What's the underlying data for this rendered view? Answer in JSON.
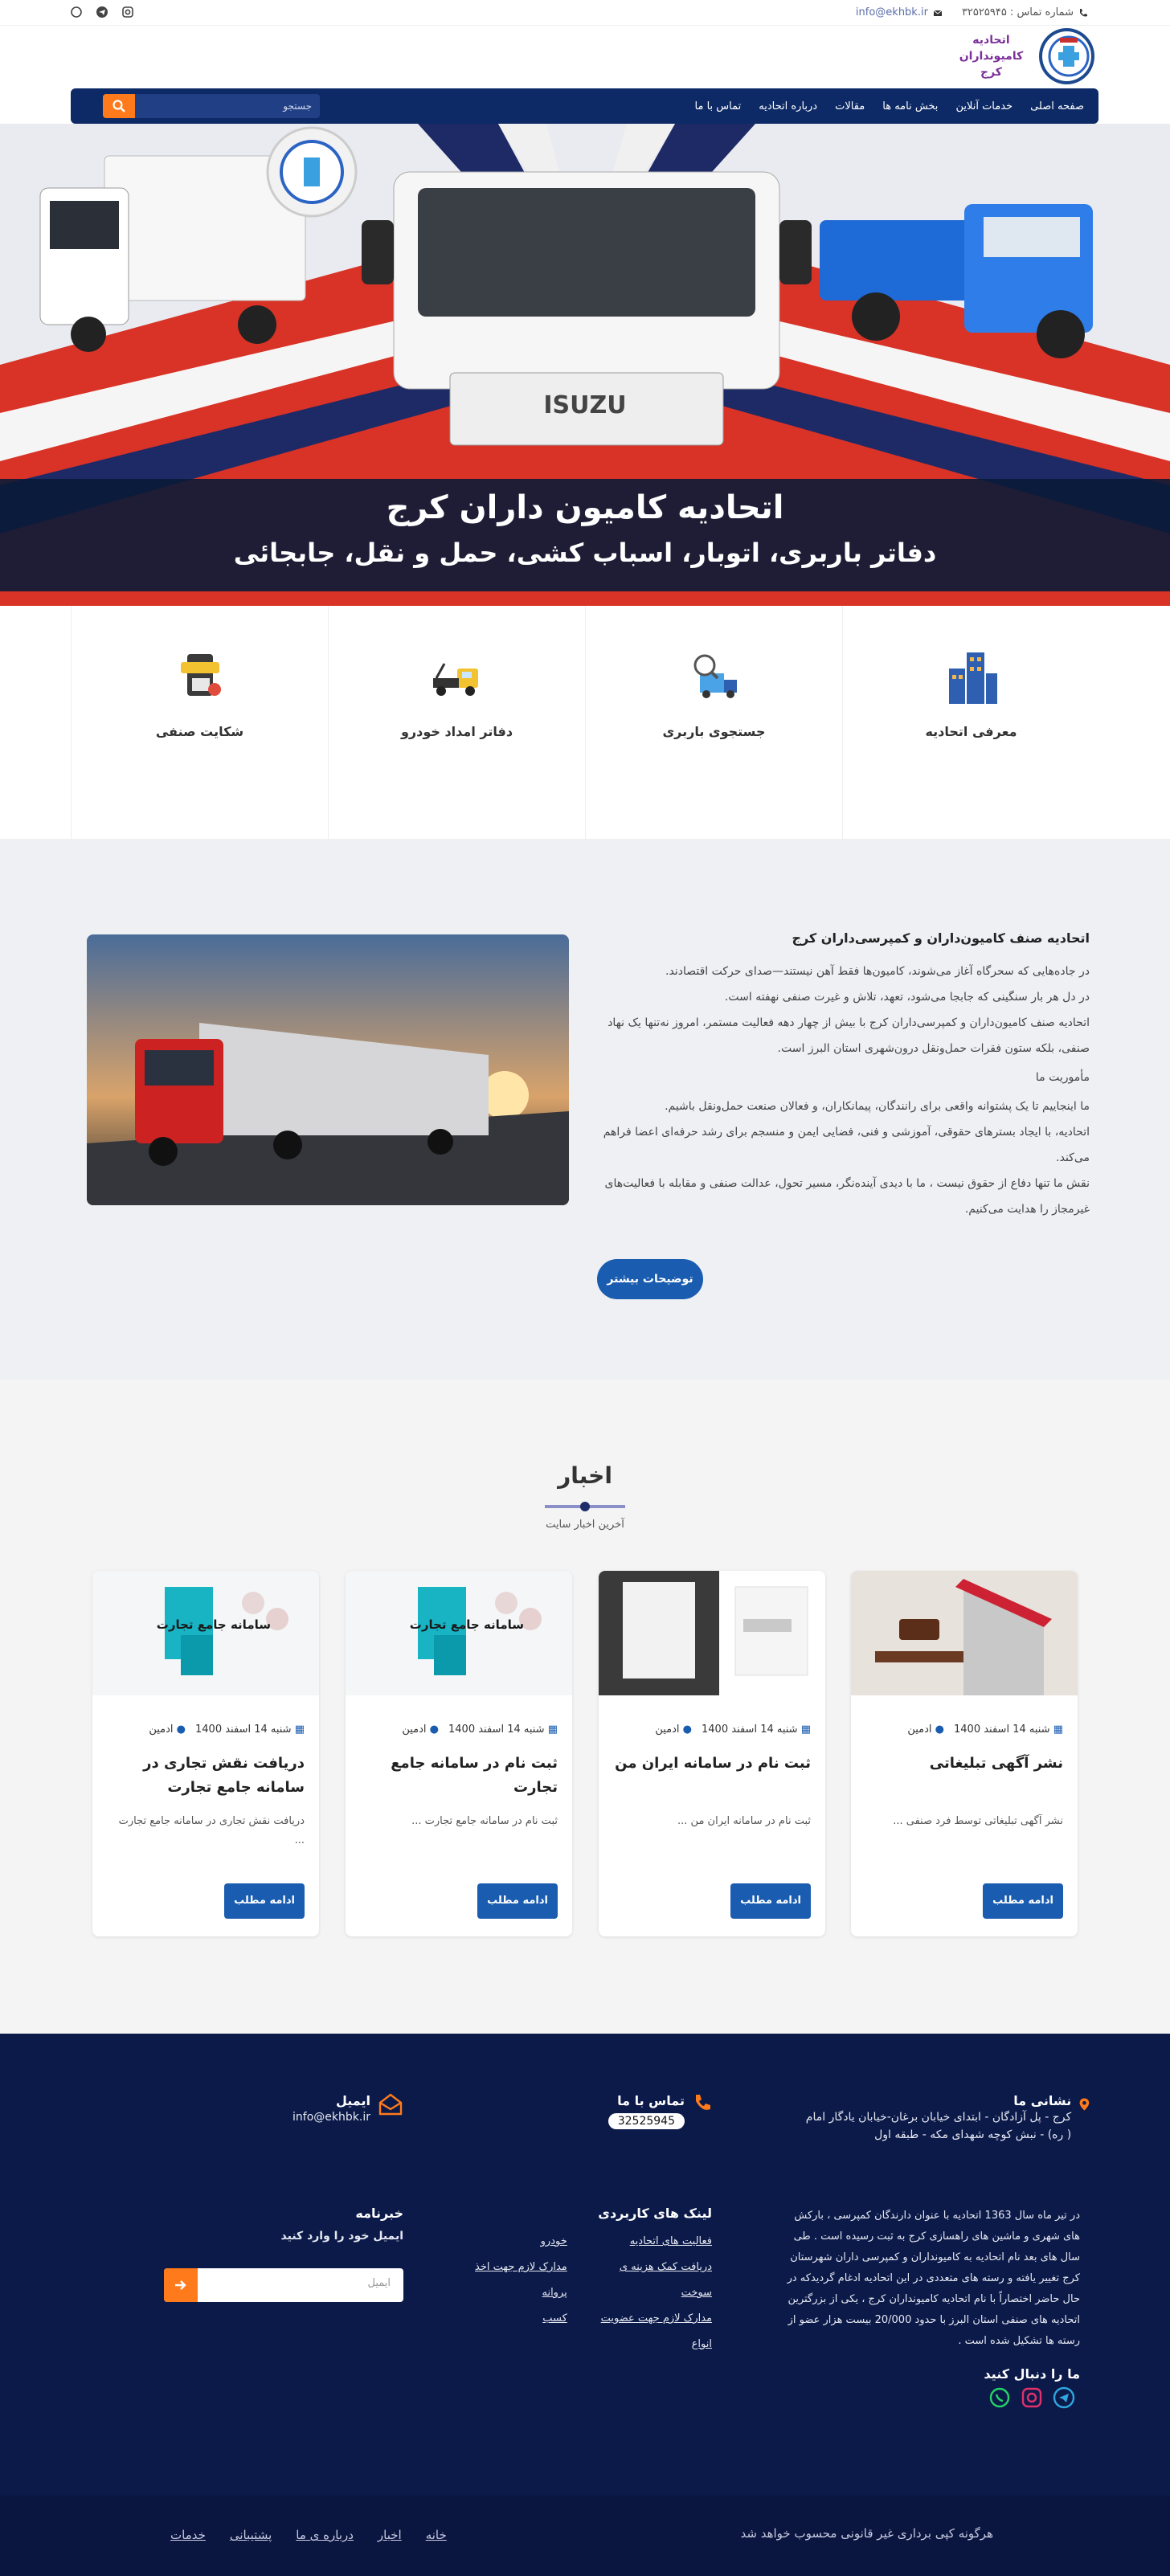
{
  "topbar": {
    "phone_label": "شماره تماس : ۳۲۵۲۵۹۴۵",
    "email": "info@ekhbk.ir",
    "social": [
      "whatsapp-icon",
      "telegram-icon",
      "instagram-icon"
    ]
  },
  "logo": {
    "line1": "اتحادیه",
    "line2": "کامیونداران کرج"
  },
  "nav": {
    "items": [
      "صفحه اصلی",
      "خدمات آنلاین",
      "بخش نامه ها",
      "مقالات",
      "درباره اتحادیه",
      "تماس با ما"
    ],
    "search_placeholder": "جستجو"
  },
  "hero": {
    "title": "اتحادیه کامیون داران کرج",
    "subtitle": "دفاتر باربری، اتوبار، اسباب کشی، حمل و نقل، جابجائی",
    "truck_brand": "ISUZU"
  },
  "services": [
    {
      "label": "معرفی اتحادیه",
      "icon": "buildings-icon"
    },
    {
      "label": "جستجوی باربری",
      "icon": "delivery-truck-search-icon"
    },
    {
      "label": "دفاتر امداد خودرو",
      "icon": "tow-truck-icon"
    },
    {
      "label": "شکایت صنفی",
      "icon": "report-icon"
    }
  ],
  "about": {
    "heading": "اتحادیه صنف کامیون‌داران و کمپرسی‌داران کرج",
    "p1": "در جاده‌هایی که سحرگاه آغاز می‌شوند، کامیون‌ها فقط آهن نیستند—صدای حرکت اقتصادند.",
    "p2": "در دل هر بار سنگینی که جابجا می‌شود، تعهد، تلاش و غیرت صنفی نهفته است.",
    "p3": "اتحادیه صنف کامیون‌داران و کمپرسی‌داران کرج با بیش از چهار دهه فعالیت مستمر، امروز نه‌تنها یک نهاد صنفی، بلکه ستون فقرات حمل‌ونقل درون‌شهری استان البرز است.",
    "mission_title": "مأموریت ما",
    "p4": "ما اینجاییم تا یک پشتوانه واقعی برای رانندگان، پیمانکاران، و فعالان صنعت حمل‌ونقل باشیم.",
    "p5": "اتحادیه، با ایجاد بسترهای حقوقی، آموزشی و فنی، فضایی ایمن و منسجم برای رشد حرفه‌ای اعضا فراهم می‌کند.",
    "p6": "نقش ما تنها دفاع از حقوق نیست ، ما با دیدی آینده‌نگر، مسیر تحول، عدالت صنفی و مقابله با فعالیت‌های غیرمجاز را هدایت می‌کنیم.",
    "more_button": "توضیحات بیشتر"
  },
  "news": {
    "title": "اخبار",
    "subtitle": "آخرین اخبار سایت",
    "cards": [
      {
        "date": "شنبه 14 اسفند 1400",
        "author": "ادمین",
        "title": "نشر آگهی تبلیغاتی",
        "excerpt": "نشر آگهی تبلیغاتی توسط فرد صنفی ...",
        "button": "ادامه مطلب"
      },
      {
        "date": "شنبه 14 اسفند 1400",
        "author": "ادمین",
        "title": "ثبت نام در سامانه ایران من",
        "excerpt": "ثبت نام در سامانه ایران من ...",
        "button": "ادامه مطلب"
      },
      {
        "date": "شنبه 14 اسفند 1400",
        "author": "ادمین",
        "title": "ثبت نام در سامانه جامع تجارت",
        "excerpt": "ثبت نام در سامانه جامع تجارت ...",
        "button": "ادامه مطلب"
      },
      {
        "date": "شنبه 14 اسفند 1400",
        "author": "ادمین",
        "title": "دریافت نقش تجاری در سامانه جامع تجارت",
        "excerpt": "دریافت نقش تجاری در سامانه جامع تجارت ...",
        "button": "ادامه مطلب"
      }
    ],
    "card_image_text": "سامانه جامع تجارت"
  },
  "footer": {
    "address_title": "نشانی ما",
    "address": "کرج - پل آزادگان - ابتدای خیابان برغان-خیابان یادگار امام ( ره) - نبش کوچه شهدای مکه - طبقه اول",
    "contact_title": "تماس با ما",
    "phone": "32525945",
    "email_title": "ایمیل",
    "email": "info@ekhbk.ir",
    "about_text": "در تیر ماه سال 1363 اتحادیه با عنوان دارندگان کمپرسی ، بارکش های شهری و ماشین های راهسازی کرج به ثبت رسیده است . طی سال های بعد نام اتحادیه به کامیونداران و کمپرسی داران شهرستان کرج تغییر یافته و رسته های متعددی در این اتحادیه ادغام گردیدکه در حال حاضر اختصاراً با نام اتحادیه کامیونداران کرج ، یکی از بزرگترین اتحادیه های صنفی استان البرز با حدود 20/000 بیست هزار عضو از رسته ها تشکیل شده است .",
    "follow_title": "ما را دنبال کنید",
    "links_title": "لینک های کاربردی",
    "links_col1": [
      "فعالیت های اتحادیه",
      "دریافت کمک هزینه ی سوخت",
      "مدارک لازم جهت عضویت انواع"
    ],
    "links_col2": [
      "خودرو",
      "مدارک لازم جهت اخذ پروانه",
      "کسب"
    ],
    "newsletter_title": "خبرنامه",
    "newsletter_sub": "ایمیل خود را وارد کنید",
    "newsletter_placeholder": "ایمیل",
    "copyright": "هرگونه کپی برداری غیر قانونی محسوب خواهد شد",
    "bottom_links": [
      "خانه",
      "اخبار",
      "درباره ی ما",
      "پشتیبانی",
      "خدمات"
    ]
  },
  "colors": {
    "navy": "#0d2a66",
    "orange": "#ff7a1a",
    "blue_btn": "#1a5cb0",
    "footer": "#0c1a4a"
  }
}
